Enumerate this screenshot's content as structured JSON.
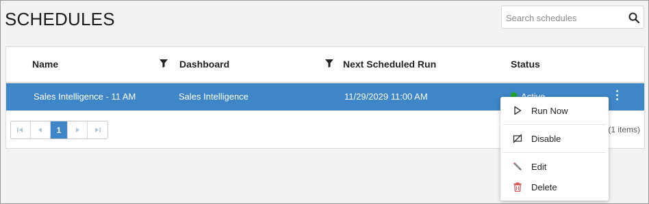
{
  "page": {
    "title": "SCHEDULES"
  },
  "search": {
    "placeholder": "Search schedules"
  },
  "table": {
    "columns": [
      "Name",
      "Dashboard",
      "Next Scheduled Run",
      "Status"
    ],
    "rows": [
      {
        "name": "Sales Intelligence - 11 AM",
        "dashboard": "Sales Intelligence",
        "next_run": "11/29/2029 11:00 AM",
        "status": "Active"
      }
    ]
  },
  "pager": {
    "current_page": "1",
    "items_count": "(1 items)"
  },
  "context_menu": {
    "items": [
      "Run Now",
      "Disable",
      "Edit",
      "Delete"
    ]
  },
  "colors": {
    "selected_row": "#3f86c8",
    "status_active": "#1fa32a",
    "delete_icon": "#d9534f"
  },
  "icons": {
    "search": "search-icon",
    "filter": "filter-icon",
    "row_menu": "vertical-ellipsis-icon",
    "run_now": "play-icon",
    "disable": "disable-icon",
    "edit": "pencil-icon",
    "delete": "trash-icon"
  }
}
